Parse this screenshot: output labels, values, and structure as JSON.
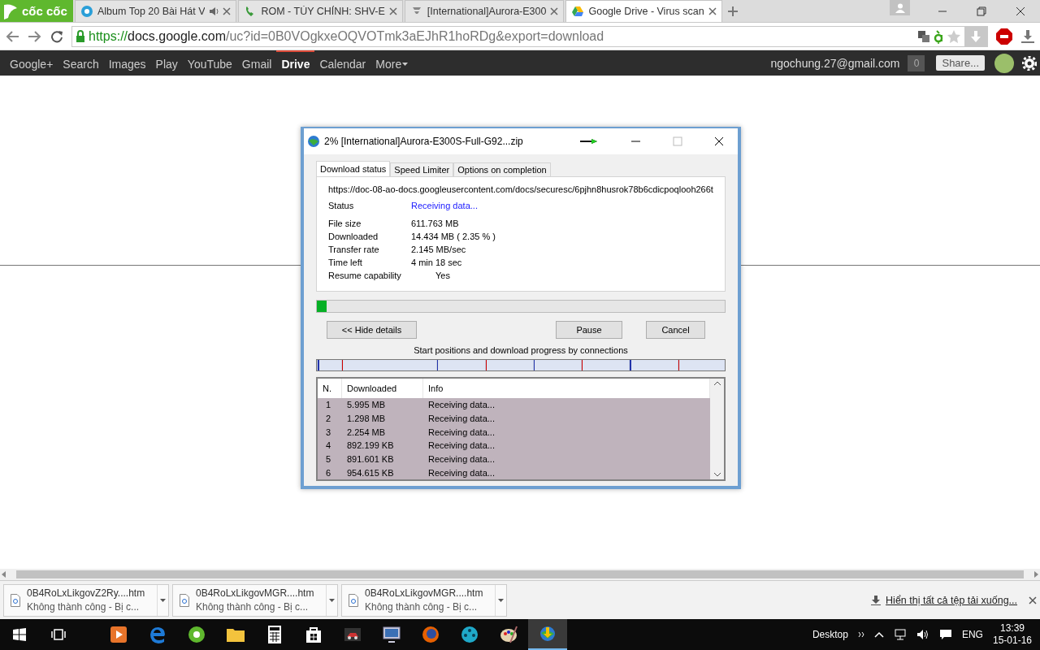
{
  "browser": {
    "logo": "cốc cốc",
    "tabs": [
      {
        "kind": "music",
        "title": "Album Top 20 Bài Hát V",
        "audio": true,
        "selected": false
      },
      {
        "kind": "phone",
        "title": "ROM - TÙY CHỈNH: SHV-E",
        "audio": false,
        "selected": false
      },
      {
        "kind": "forum",
        "title": "[International]Aurora-E300",
        "audio": false,
        "selected": false
      },
      {
        "kind": "drive",
        "title": "Google Drive - Virus scan",
        "audio": false,
        "selected": true
      }
    ],
    "url_scheme": "https://",
    "url_host": "docs.google.com",
    "url_path": "/uc?id=0B0VOgkxeOQVOTmk3aEJhR1hoRDg&export=download"
  },
  "google_bar": {
    "items": [
      {
        "label": "Google+",
        "selected": false
      },
      {
        "label": "Search",
        "selected": false
      },
      {
        "label": "Images",
        "selected": false
      },
      {
        "label": "Play",
        "selected": false
      },
      {
        "label": "YouTube",
        "selected": false
      },
      {
        "label": "Gmail",
        "selected": false
      },
      {
        "label": "Drive",
        "selected": true
      },
      {
        "label": "Calendar",
        "selected": false
      },
      {
        "label": "More",
        "selected": false
      }
    ],
    "account": "ngochung.27@gmail.com",
    "notifications": "0",
    "share": "Share..."
  },
  "dialog": {
    "title": "2% [International]Aurora-E300S-Full-G92...zip",
    "tabs": [
      {
        "label": "Download status",
        "selected": true
      },
      {
        "label": "Speed Limiter",
        "selected": false
      },
      {
        "label": "Options on completion",
        "selected": false
      }
    ],
    "url": "https://doc-08-ao-docs.googleusercontent.com/docs/securesc/6pjhn8husrok78b6cdicpoqlooh266t",
    "status_label": "Status",
    "status_value": "Receiving data...",
    "details": [
      {
        "label": "File size",
        "value": "611.763  MB"
      },
      {
        "label": "Downloaded",
        "value": "14.434  MB  ( 2.35 % )"
      },
      {
        "label": "Transfer rate",
        "value": "2.145  MB/sec"
      },
      {
        "label": "Time left",
        "value": "4 min 18 sec"
      }
    ],
    "resume_label": "Resume capability",
    "resume_value": "Yes",
    "progress": {
      "level": 0.0235
    },
    "buttons": {
      "hide": "<< Hide details",
      "pause": "Pause",
      "cancel": "Cancel"
    },
    "connections_caption": "Start positions and download progress by connections",
    "connections": [
      {
        "level": 0.08
      },
      {
        "level": 0.01
      },
      {
        "level": 0.02
      },
      {
        "level": 0.01
      },
      {
        "level": 0.02
      },
      {
        "level": 0.01
      },
      {
        "level": 0.02
      },
      {
        "level": 0.01
      }
    ],
    "table": {
      "columns": [
        "N.",
        "Downloaded",
        "Info"
      ],
      "rows": [
        [
          "1",
          "5.995  MB",
          "Receiving data..."
        ],
        [
          "2",
          "1.298  MB",
          "Receiving data..."
        ],
        [
          "3",
          "2.254  MB",
          "Receiving data..."
        ],
        [
          "4",
          "892.199  KB",
          "Receiving data..."
        ],
        [
          "5",
          "891.601  KB",
          "Receiving data..."
        ],
        [
          "6",
          "954.615  KB",
          "Receiving data..."
        ]
      ]
    }
  },
  "downloads": {
    "items": [
      {
        "name": "0B4RoLxLikgovZ2Ry....htm",
        "status": "Không thành công - Bị c..."
      },
      {
        "name": "0B4RoLxLikgovMGR....htm",
        "status": "Không thành công - Bị c..."
      },
      {
        "name": "0B4RoLxLikgovMGR....htm",
        "status": "Không thành công - Bị c..."
      }
    ],
    "show_all": "Hiển thị tất cả tệp tải xuống..."
  },
  "taskbar": {
    "apps": [
      {
        "kind": "media",
        "selected": false
      },
      {
        "kind": "edge",
        "selected": false
      },
      {
        "kind": "coccoc",
        "selected": false
      },
      {
        "kind": "folder",
        "selected": false
      },
      {
        "kind": "calculator",
        "selected": false
      },
      {
        "kind": "store",
        "selected": false
      },
      {
        "kind": "car",
        "selected": false
      },
      {
        "kind": "monitor",
        "selected": false
      },
      {
        "kind": "firefox",
        "selected": false
      },
      {
        "kind": "reel",
        "selected": false
      },
      {
        "kind": "palette",
        "selected": false
      },
      {
        "kind": "idm",
        "selected": true
      }
    ],
    "desktop": "Desktop",
    "language": "ENG",
    "time": "13:39",
    "date": "15-01-16"
  }
}
